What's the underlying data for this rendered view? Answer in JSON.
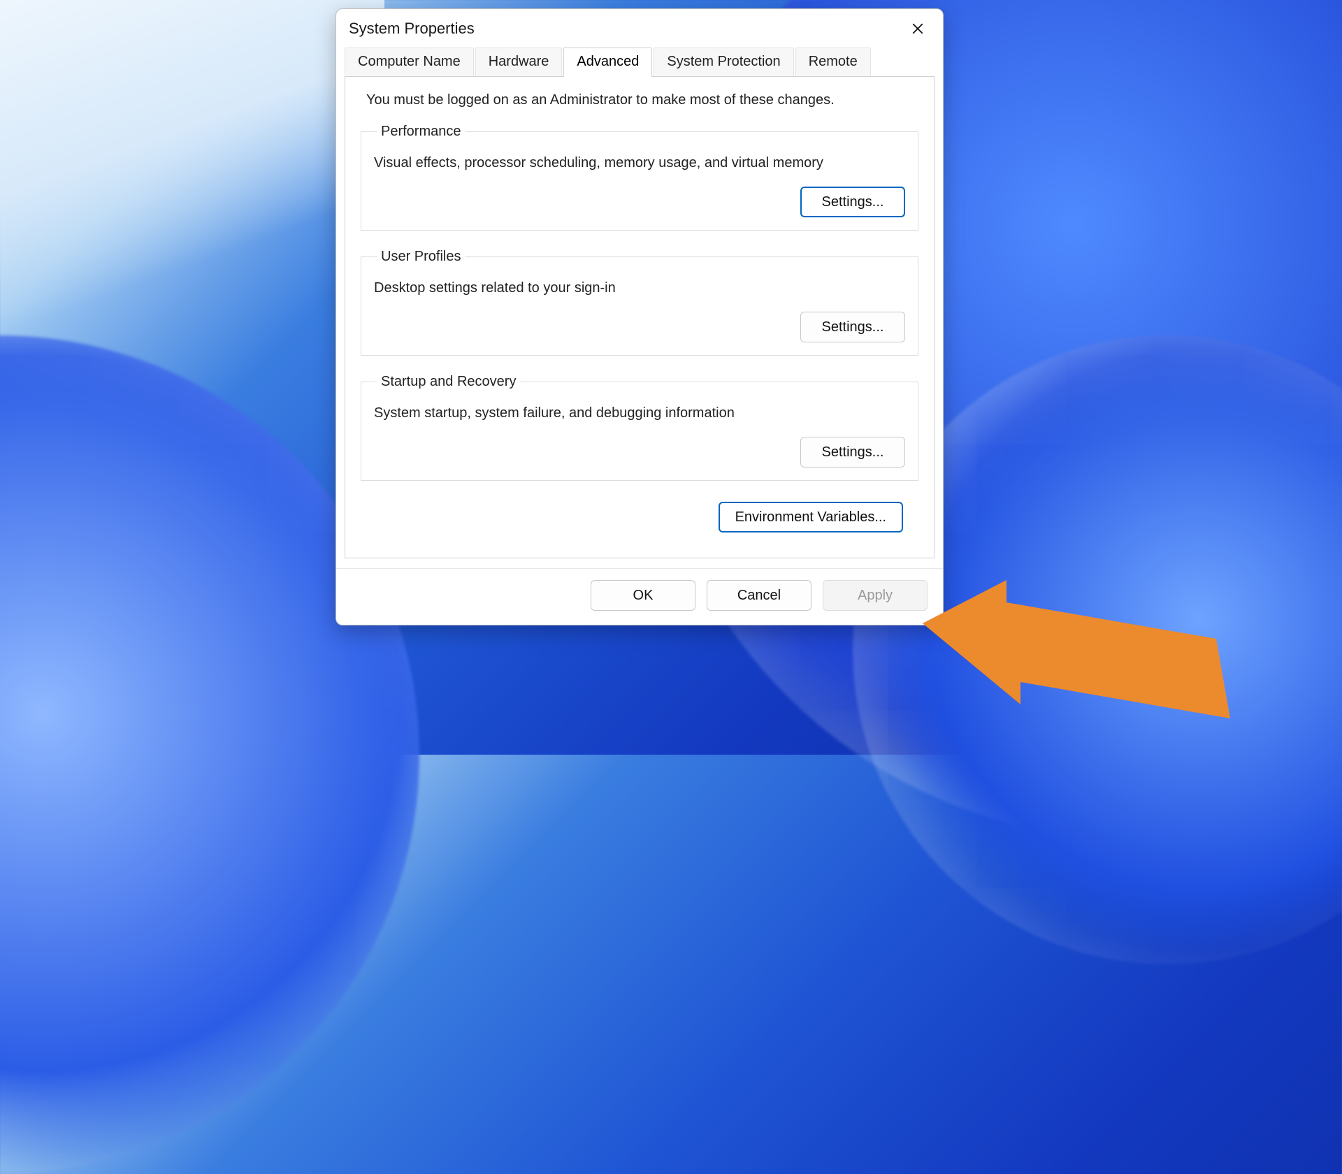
{
  "window": {
    "title": "System Properties"
  },
  "tabs": [
    {
      "label": "Computer Name",
      "active": false
    },
    {
      "label": "Hardware",
      "active": false
    },
    {
      "label": "Advanced",
      "active": true
    },
    {
      "label": "System Protection",
      "active": false
    },
    {
      "label": "Remote",
      "active": false
    }
  ],
  "panel": {
    "admin_note": "You must be logged on as an Administrator to make most of these changes.",
    "groups": {
      "performance": {
        "legend": "Performance",
        "desc": "Visual effects, processor scheduling, memory usage, and virtual memory",
        "button": "Settings..."
      },
      "user_profiles": {
        "legend": "User Profiles",
        "desc": "Desktop settings related to your sign-in",
        "button": "Settings..."
      },
      "startup": {
        "legend": "Startup and Recovery",
        "desc": "System startup, system failure, and debugging information",
        "button": "Settings..."
      }
    },
    "env_button": "Environment Variables..."
  },
  "footer": {
    "ok": "OK",
    "cancel": "Cancel",
    "apply": "Apply"
  },
  "annotation": {
    "arrow_color": "#ec8a2e"
  }
}
